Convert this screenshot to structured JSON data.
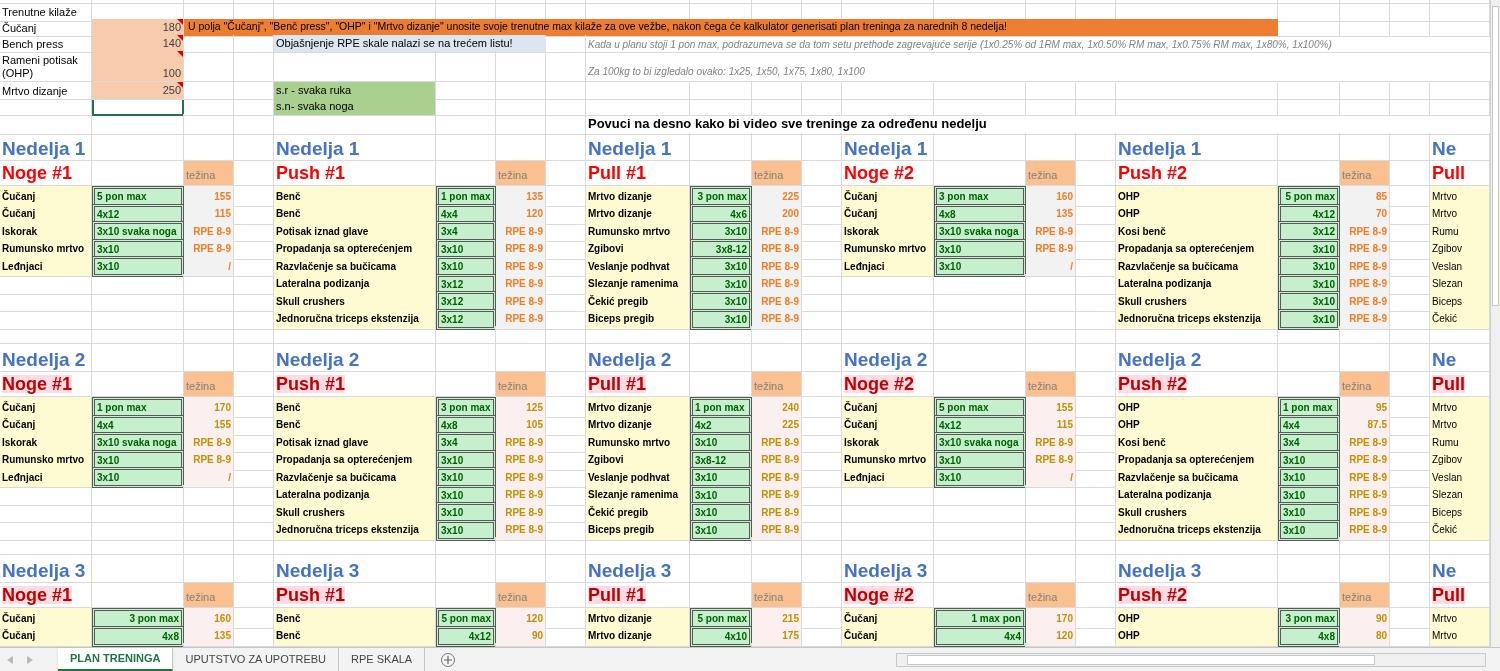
{
  "inputs": {
    "title": "Trenutne kilaže",
    "active_cell_below": true,
    "lifts": [
      {
        "name": "Čučanj",
        "value": "180",
        "comment": true
      },
      {
        "name": "Bench press",
        "value": "140",
        "comment": true
      },
      {
        "name": "Rameni potisak (OHP)",
        "value": "100",
        "comment": true
      },
      {
        "name": "Mrtvo dizanje",
        "value": "250",
        "comment": true
      }
    ]
  },
  "banner": "U polja \"Čučanj\", \"Benč press\", \"OHP\" i \"Mrtvo dizanje\" unosite svoje trenutne max kilaže za ove vežbe, nakon čega će kalkulator generisati plan treninga za narednih 8 nedelja!",
  "rpe_note": "Objašnjenje RPE skale nalazi se na trećem listu!",
  "notes": [
    "Kada u planu stoji 1 pon max, podrazumeva se da tom setu prethode zagrevajuće serije (1x0.25% od 1RM max, 1x0.50% RM max, 1x0.75% RM max, 1x80%, 1x100%)",
    "Za 100kg to bi izgledalo ovako: 1x25, 1x50, 1x75, 1x80, 1x100"
  ],
  "legend": [
    "s.r - svaka ruka",
    "s.n- svaka noga"
  ],
  "scroll_hint": "Povuci na desno kako bi video sve treninge za određenu nedelju",
  "weeks": [
    {
      "highlighted": false,
      "workouts": [
        {
          "heading": "Nedelja 1",
          "title": "Noge #1",
          "weight_header": "težina",
          "right_aligned": false,
          "exercises": [
            {
              "name": "Čučanj",
              "scheme": "5 pon max",
              "weight": "155"
            },
            {
              "name": "Čučanj",
              "scheme": "4x12",
              "weight": "115"
            },
            {
              "name": "Iskorak",
              "scheme": "3x10 svaka noga",
              "weight": "RPE 8-9"
            },
            {
              "name": "Rumunsko mrtvo",
              "scheme": "3x10",
              "weight": "RPE 8-9"
            },
            {
              "name": "Leđnjaci",
              "scheme": "3x10",
              "weight": "/"
            }
          ]
        },
        {
          "heading": "Nedelja 1",
          "title": "Push #1",
          "weight_header": "težina",
          "right_aligned": false,
          "exercises": [
            {
              "name": "Benč",
              "scheme": "1 pon max",
              "weight": "135"
            },
            {
              "name": "Benč",
              "scheme": "4x4",
              "weight": "120"
            },
            {
              "name": "Potisak iznad glave",
              "scheme": "3x4",
              "weight": "RPE 8-9"
            },
            {
              "name": "Propadanja sa opterećenjem",
              "scheme": "3x10",
              "weight": "RPE 8-9"
            },
            {
              "name": "Razvlačenje sa bučicama",
              "scheme": "3x10",
              "weight": "RPE 8-9"
            },
            {
              "name": "Lateralna podizanja",
              "scheme": "3x12",
              "weight": "RPE 8-9"
            },
            {
              "name": "Skull crushers",
              "scheme": "3x12",
              "weight": "RPE 8-9"
            },
            {
              "name": "Jednoručna triceps ekstenzija",
              "scheme": "3x12",
              "weight": "RPE 8-9"
            }
          ]
        },
        {
          "heading": "Nedelja 1",
          "title": "Pull #1",
          "weight_header": "težina",
          "right_aligned": true,
          "exercises": [
            {
              "name": "Mrtvo dizanje",
              "scheme": "3 pon max",
              "weight": "225"
            },
            {
              "name": "Mrtvo dizanje",
              "scheme": "4x6",
              "weight": "200"
            },
            {
              "name": "Rumunsko mrtvo",
              "scheme": "3x10",
              "weight": "RPE 8-9"
            },
            {
              "name": "Zgibovi",
              "scheme": "3x8-12",
              "weight": "RPE 8-9"
            },
            {
              "name": "Veslanje podhvat",
              "scheme": "3x10",
              "weight": "RPE 8-9"
            },
            {
              "name": "Slezanje ramenima",
              "scheme": "3x10",
              "weight": "RPE 8-9"
            },
            {
              "name": "Čekić pregib",
              "scheme": "3x10",
              "weight": "RPE 8-9"
            },
            {
              "name": "Biceps pregib",
              "scheme": "3x10",
              "weight": "RPE 8-9"
            }
          ]
        },
        {
          "heading": "Nedelja 1",
          "title": "Noge #2",
          "weight_header": "težina",
          "right_aligned": false,
          "exercises": [
            {
              "name": "Čučanj",
              "scheme": "3 pon max",
              "weight": "160"
            },
            {
              "name": "Čučanj",
              "scheme": "4x8",
              "weight": "135"
            },
            {
              "name": "Iskorak",
              "scheme": "3x10 svaka noga",
              "weight": "RPE 8-9"
            },
            {
              "name": "Rumunsko mrtvo",
              "scheme": "3x10",
              "weight": "RPE 8-9"
            },
            {
              "name": "Leđnjaci",
              "scheme": "3x10",
              "weight": "/"
            }
          ]
        },
        {
          "heading": "Nedelja 1",
          "title": "Push #2",
          "weight_header": "težina",
          "right_aligned": true,
          "exercises": [
            {
              "name": "OHP",
              "scheme": "5 pon max",
              "weight": "85"
            },
            {
              "name": "OHP",
              "scheme": "4x12",
              "weight": "70"
            },
            {
              "name": "Kosi benč",
              "scheme": "3x12",
              "weight": "RPE 8-9"
            },
            {
              "name": "Propadanja sa opterećenjem",
              "scheme": "3x10",
              "weight": "RPE 8-9"
            },
            {
              "name": "Razvlačenje sa bučicama",
              "scheme": "3x10",
              "weight": "RPE 8-9"
            },
            {
              "name": "Lateralna podizanja",
              "scheme": "3x10",
              "weight": "RPE 8-9"
            },
            {
              "name": "Skull crushers",
              "scheme": "3x10",
              "weight": "RPE 8-9"
            },
            {
              "name": "Jednoručna triceps ekstenzija",
              "scheme": "3x10",
              "weight": "RPE 8-9"
            }
          ]
        }
      ],
      "cut_off": {
        "heading": "Ne",
        "title": "Pull",
        "exercises": [
          "Mrtvo",
          "Mrtvo",
          "Rumu",
          "Zgibov",
          "Veslan",
          "Slezan",
          "Biceps",
          "Čekić"
        ]
      }
    },
    {
      "highlighted": true,
      "workouts": [
        {
          "heading": "Nedelja 2",
          "title": "Noge #1",
          "weight_header": "težina",
          "right_aligned": false,
          "exercises": [
            {
              "name": "Čučanj",
              "scheme": "1 pon max",
              "weight": "170"
            },
            {
              "name": "Čučanj",
              "scheme": "4x4",
              "weight": "155"
            },
            {
              "name": "Iskorak",
              "scheme": "3x10 svaka noga",
              "weight": "RPE 8-9"
            },
            {
              "name": "Rumunsko mrtvo",
              "scheme": "3x10",
              "weight": "RPE 8-9"
            },
            {
              "name": "Leđnjaci",
              "scheme": "3x10",
              "weight": "/"
            }
          ]
        },
        {
          "heading": "Nedelja 2",
          "title": "Push #1",
          "weight_header": "težina",
          "right_aligned": false,
          "exercises": [
            {
              "name": "Benč",
              "scheme": "3 pon max",
              "weight": "125"
            },
            {
              "name": "Benč",
              "scheme": "4x8",
              "weight": "105"
            },
            {
              "name": "Potisak iznad glave",
              "scheme": "3x4",
              "weight": "RPE 8-9"
            },
            {
              "name": "Propadanja sa opterećenjem",
              "scheme": "3x10",
              "weight": "RPE 8-9"
            },
            {
              "name": "Razvlačenje sa bučicama",
              "scheme": "3x10",
              "weight": "RPE 8-9"
            },
            {
              "name": "Lateralna podizanja",
              "scheme": "3x10",
              "weight": "RPE 8-9"
            },
            {
              "name": "Skull crushers",
              "scheme": "3x10",
              "weight": "RPE 8-9"
            },
            {
              "name": "Jednoručna triceps ekstenzija",
              "scheme": "3x10",
              "weight": "RPE 8-9"
            }
          ]
        },
        {
          "heading": "Nedelja 2",
          "title": "Pull #1",
          "weight_header": "težina",
          "right_aligned": false,
          "exercises": [
            {
              "name": "Mrtvo dizanje",
              "scheme": "1 pon max",
              "weight": "240"
            },
            {
              "name": "Mrtvo dizanje",
              "scheme": "4x2",
              "weight": "225"
            },
            {
              "name": "Rumunsko mrtvo",
              "scheme": "3x10",
              "weight": "RPE 8-9"
            },
            {
              "name": "Zgibovi",
              "scheme": "3x8-12",
              "weight": "RPE 8-9"
            },
            {
              "name": "Veslanje podhvat",
              "scheme": "3x10",
              "weight": "RPE 8-9"
            },
            {
              "name": "Slezanje ramenima",
              "scheme": "3x10",
              "weight": "RPE 8-9"
            },
            {
              "name": "Čekić pregib",
              "scheme": "3x10",
              "weight": "RPE 8-9"
            },
            {
              "name": "Biceps pregib",
              "scheme": "3x10",
              "weight": "RPE 8-9"
            }
          ]
        },
        {
          "heading": "Nedelja 2",
          "title": "Noge #2",
          "weight_header": "težina",
          "right_aligned": false,
          "exercises": [
            {
              "name": "Čučanj",
              "scheme": "5 pon max",
              "weight": "155"
            },
            {
              "name": "Čučanj",
              "scheme": "4x12",
              "weight": "115"
            },
            {
              "name": "Iskorak",
              "scheme": "3x10 svaka noga",
              "weight": "RPE 8-9"
            },
            {
              "name": "Rumunsko mrtvo",
              "scheme": "3x10",
              "weight": "RPE 8-9"
            },
            {
              "name": "Leđnjaci",
              "scheme": "3x10",
              "weight": "/"
            }
          ]
        },
        {
          "heading": "Nedelja 2",
          "title": "Push #2",
          "weight_header": "težina",
          "right_aligned": false,
          "exercises": [
            {
              "name": "OHP",
              "scheme": "1 pon max",
              "weight": "95"
            },
            {
              "name": "OHP",
              "scheme": "4x4",
              "weight": "87.5"
            },
            {
              "name": "Kosi benč",
              "scheme": "3x4",
              "weight": "RPE 8-9"
            },
            {
              "name": "Propadanja sa opterećenjem",
              "scheme": "3x10",
              "weight": "RPE 8-9"
            },
            {
              "name": "Razvlačenje sa bučicama",
              "scheme": "3x10",
              "weight": "RPE 8-9"
            },
            {
              "name": "Lateralna podizanja",
              "scheme": "3x10",
              "weight": "RPE 8-9"
            },
            {
              "name": "Skull crushers",
              "scheme": "3x10",
              "weight": "RPE 8-9"
            },
            {
              "name": "Jednoručna triceps ekstenzija",
              "scheme": "3x10",
              "weight": "RPE 8-9"
            }
          ]
        }
      ],
      "cut_off": {
        "heading": "Ne",
        "title": "Pull",
        "exercises": [
          "Mrtvo",
          "Mrtvo",
          "Rumu",
          "Zgibov",
          "Veslan",
          "Slezan",
          "Biceps",
          "Čekić"
        ]
      }
    },
    {
      "highlighted": true,
      "workouts": [
        {
          "heading": "Nedelja 3",
          "title": "Noge #1",
          "weight_header": "težina",
          "right_aligned": true,
          "exercises": [
            {
              "name": "Čučanj",
              "scheme": "3  pon max",
              "weight": "160"
            },
            {
              "name": "Čučanj",
              "scheme": "4x8",
              "weight": "135"
            }
          ]
        },
        {
          "heading": "Nedelja 3",
          "title": "Push #1",
          "weight_header": "težina",
          "right_aligned": true,
          "exercises": [
            {
              "name": "Benč",
              "scheme": "5 pon max",
              "weight": "120"
            },
            {
              "name": "Benč",
              "scheme": "4x12",
              "weight": "90"
            }
          ]
        },
        {
          "heading": "Nedelja 3",
          "title": "Pull #1",
          "weight_header": "težina",
          "right_aligned": true,
          "exercises": [
            {
              "name": "Mrtvo dizanje",
              "scheme": "5 pon max",
              "weight": "215"
            },
            {
              "name": "Mrtvo dizanje",
              "scheme": "4x10",
              "weight": "175"
            }
          ]
        },
        {
          "heading": "Nedelja 3",
          "title": "Noge #2",
          "weight_header": "težina",
          "right_aligned": true,
          "exercises": [
            {
              "name": "Čučanj",
              "scheme": "1 max pon",
              "weight": "170"
            },
            {
              "name": "Čučanj",
              "scheme": "4x4",
              "weight": "120"
            }
          ]
        },
        {
          "heading": "Nedelja 3",
          "title": "Push #2",
          "weight_header": "težina",
          "right_aligned": true,
          "exercises": [
            {
              "name": "OHP",
              "scheme": "3 pon max",
              "weight": "90"
            },
            {
              "name": "OHP",
              "scheme": "4x8",
              "weight": "80"
            }
          ]
        }
      ],
      "cut_off": {
        "heading": "Ne",
        "title": "Pull",
        "exercises": [
          "Mrtvo",
          "Mrtvo"
        ]
      }
    }
  ],
  "sheet_tabs": [
    {
      "label": "PLAN TRENINGA",
      "selected": true
    },
    {
      "label": "UPUTSTVO ZA UPOTREBU",
      "selected": false
    },
    {
      "label": "RPE SKALA",
      "selected": false
    }
  ]
}
